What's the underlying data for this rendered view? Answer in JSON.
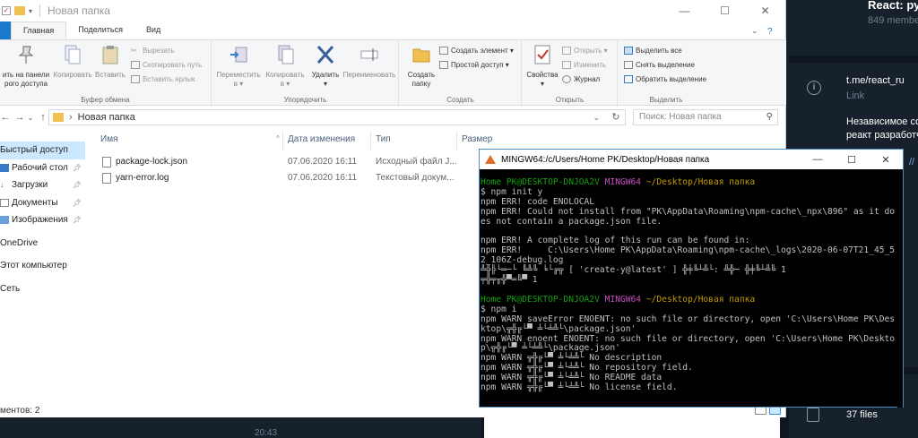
{
  "explorer": {
    "title": "Новая папка",
    "tabs": [
      "Главная",
      "Поделиться",
      "Вид"
    ],
    "window_controls": [
      "—",
      "☐",
      "✕"
    ],
    "ribbon": {
      "clipboard": {
        "pin_label": "ить на панели\nрого доступа",
        "copy": "Копировать",
        "paste": "Вставить",
        "cut": "Вырезать",
        "copy_path": "Скопировать путь",
        "paste_shortcut": "Вставить ярлык",
        "group": "Буфер обмена"
      },
      "organize": {
        "move": "Переместить\nв ▾",
        "copy_to": "Копировать\nв ▾",
        "delete": "Удалить\n▾",
        "rename": "Переименовать",
        "group": "Упорядочить"
      },
      "create": {
        "new_folder": "Создать\nпапку",
        "new_item": "Создать элемент ▾",
        "easy_access": "Простой доступ ▾",
        "group": "Создать"
      },
      "open": {
        "properties": "Свойства\n▾",
        "open": "Открыть ▾",
        "edit": "Изменить",
        "history": "Журнал",
        "group": "Открыть"
      },
      "select": {
        "select_all": "Выделить все",
        "select_none": "Снять выделение",
        "invert": "Обратить выделение",
        "group": "Выделить"
      }
    },
    "address": "Новая папка",
    "search_placeholder": "Поиск: Новая папка",
    "sidebar": [
      {
        "label": "Быстрый доступ",
        "selected": true,
        "pinned": false
      },
      {
        "label": "Рабочий стол",
        "pinned": true
      },
      {
        "label": "Загрузки",
        "pinned": true
      },
      {
        "label": "Документы",
        "pinned": true
      },
      {
        "label": "Изображения",
        "pinned": true
      },
      {
        "label": "OneDrive",
        "pinned": false
      },
      {
        "label": "Этот компьютер",
        "pinned": false
      },
      {
        "label": "Сеть",
        "pinned": false
      }
    ],
    "columns": [
      "Имя",
      "Дата изменения",
      "Тип",
      "Размер"
    ],
    "files": [
      {
        "name": "package-lock.json",
        "date": "07.06.2020 16:11",
        "type": "Исходный файл J..."
      },
      {
        "name": "yarn-error.log",
        "date": "07.06.2020 16:11",
        "type": "Текстовый докум..."
      }
    ],
    "status": "ментов: 2"
  },
  "terminal": {
    "title": "MINGW64:/c/Users/Home PK/Desktop/Новая папка",
    "controls": [
      "—",
      "☐",
      "✕"
    ],
    "prompt_user": "Home PK@DESKTOP-DNJOA2V",
    "prompt_env": "MINGW64",
    "prompt_path": "~/Desktop/Новая папка",
    "cmd1": "$ npm init y",
    "out1": [
      "npm ERR! code ENOLOCAL",
      "npm ERR! Could not install from \"PK\\AppData\\Roaming\\npm-cache\\_npx\\896\" as it do",
      "es not contain a package.json file.",
      "",
      "npm ERR! A complete log of this run can be found in:",
      "npm ERR!     C:\\Users\\Home PK\\AppData\\Roaming\\npm-cache\\_logs\\2020-06-07T21_45_5",
      "2_106Z-debug.log",
      "╩╬╠└═─└ ╚╩╚ ╘└╔╦ [ 'create-y@latest' ] ╬╪╚┴╩└: ╩╬─ ╬╪╚┴╩╚ 1",
      "╤╬╤╥╬▀═╚▀ 1"
    ],
    "cmd2": "$ npm i",
    "out2": [
      "npm WARN saveError ENOENT: no such file or directory, open 'C:\\Users\\Home PK\\Des",
      "ktop\\╦╬╔└▀ ╧└╧╩└\\package.json'",
      "npm WARN enoent ENOENT: no such file or directory, open 'C:\\Users\\Home PK\\Deskto",
      "p\\╦╬╔└▀ ╧└╧╩└\\package.json'",
      "npm WARN ╦╬╔└▀ ╧└╧╩└ No description",
      "npm WARN ╦╬╔└▀ ╧└╧╩└ No repository field.",
      "npm WARN ╦╬╔└▀ ╧└╧╩└ No README data",
      "npm WARN ╦╬╔└▀ ╧└╧╩└ No license field."
    ]
  },
  "telegram": {
    "group_name": "React: ру",
    "members": "849 member",
    "link": "t.me/react_ru",
    "link_label": "Link",
    "description": "Независимое со\nреакт разработч",
    "files_count": "37 files",
    "time": "20:43"
  }
}
